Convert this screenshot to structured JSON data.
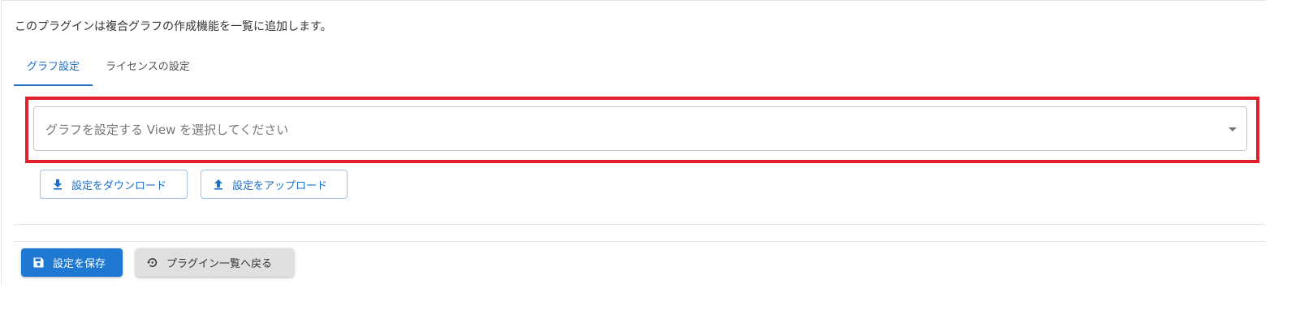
{
  "description": "このプラグインは複合グラフの作成機能を一覧に追加します。",
  "tabs": [
    {
      "label": "グラフ設定",
      "active": true
    },
    {
      "label": "ライセンスの設定",
      "active": false
    }
  ],
  "view_select": {
    "placeholder": "グラフを設定する View を選択してください",
    "icon": "chevron-down-icon"
  },
  "settings_actions": {
    "download_label": "設定をダウンロード",
    "download_icon": "download-icon",
    "upload_label": "設定をアップロード",
    "upload_icon": "upload-icon"
  },
  "footer": {
    "save_label": "設定を保存",
    "save_icon": "save-icon",
    "back_label": "プラグイン一覧へ戻る",
    "back_icon": "history-icon"
  },
  "colors": {
    "primary": "#1f78d1",
    "highlight": "#e0202a",
    "secondary_button": "#e0e0e0"
  }
}
